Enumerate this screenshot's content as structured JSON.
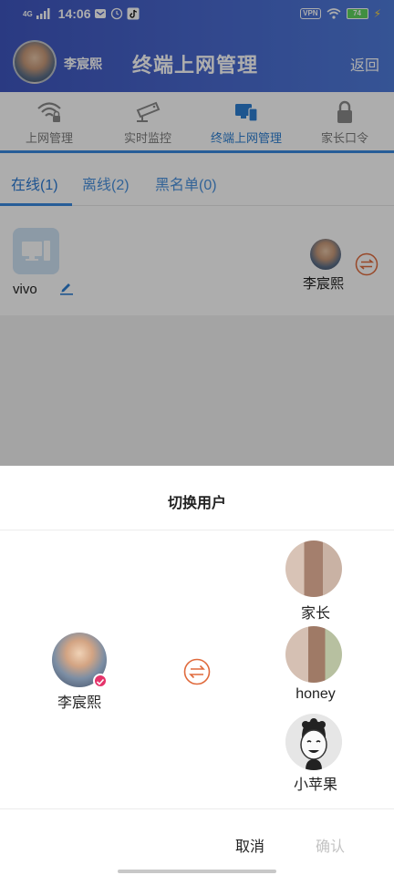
{
  "status_bar": {
    "network": "4G",
    "time": "14:06",
    "vpn": "VPN",
    "battery": "74"
  },
  "header": {
    "username": "李宸熙",
    "title": "终端上网管理",
    "back": "返回"
  },
  "tabs": [
    {
      "label": "上网管理",
      "icon": "wifi-lock-icon"
    },
    {
      "label": "实时监控",
      "icon": "camera-icon"
    },
    {
      "label": "终端上网管理",
      "icon": "devices-icon"
    },
    {
      "label": "家长口令",
      "icon": "lock-icon"
    }
  ],
  "subtabs": [
    {
      "label": "在线(1)"
    },
    {
      "label": "离线(2)"
    },
    {
      "label": "黑名单(0)"
    }
  ],
  "device": {
    "name": "vivo",
    "user": "李宸熙"
  },
  "dialog": {
    "title": "切换用户",
    "current_user": "李宸熙",
    "options": [
      {
        "name": "家长"
      },
      {
        "name": "honey"
      },
      {
        "name": "小苹果"
      }
    ],
    "cancel": "取消",
    "confirm": "确认"
  },
  "colors": {
    "accent": "#2d7fd3",
    "header_start": "#3f56c0",
    "header_end": "#4f7cdb",
    "switch": "#e06a3c",
    "badge": "#e5336a"
  }
}
